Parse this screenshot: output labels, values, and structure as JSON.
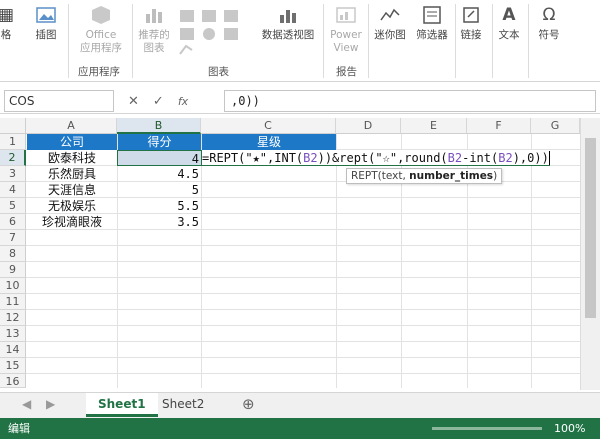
{
  "ribbon": {
    "buttons": [
      {
        "label": "格",
        "icon": "table-icon"
      },
      {
        "label": "插图",
        "icon": "picture-icon"
      },
      {
        "label": "Office\n应用程序",
        "icon": "office-apps-icon"
      },
      {
        "label": "推荐的\n图表",
        "icon": "recommended-charts-icon"
      },
      {
        "label": "数据透视图",
        "icon": "pivot-chart-icon"
      },
      {
        "label": "Power\nView",
        "icon": "power-view-icon"
      },
      {
        "label": "迷你图",
        "icon": "sparkline-icon"
      },
      {
        "label": "筛选器",
        "icon": "filter-icon"
      },
      {
        "label": "链接",
        "icon": "link-icon"
      },
      {
        "label": "文本",
        "icon": "text-icon"
      },
      {
        "label": "符号",
        "icon": "omega-icon"
      }
    ],
    "groups": {
      "apps": "应用程序",
      "charts": "图表",
      "reports": "报告"
    }
  },
  "formula_bar": {
    "name_box": "COS",
    "cancel": "✕",
    "enter": "✓",
    "fx": "fx",
    "content": ",0))"
  },
  "columns": [
    "A",
    "B",
    "C",
    "D",
    "E",
    "F",
    "G"
  ],
  "rows": [
    "1",
    "2",
    "3",
    "4",
    "5",
    "6",
    "7",
    "8",
    "9",
    "10",
    "11",
    "12",
    "13",
    "14",
    "15",
    "16"
  ],
  "table": {
    "headers": [
      "公司",
      "得分",
      "星级"
    ],
    "data": [
      {
        "company": "欧泰科技",
        "score": "4"
      },
      {
        "company": "乐然厨具",
        "score": "4.5"
      },
      {
        "company": "天涯信息",
        "score": "5"
      },
      {
        "company": "无极娱乐",
        "score": "5.5"
      },
      {
        "company": "珍视滴眼液",
        "score": "3.5"
      }
    ]
  },
  "editor": {
    "p1": "=REPT(\"★\",INT(",
    "r1": "B2",
    "p2": "))&rept(\"☆\",round(",
    "r2": "B2",
    "p3": "-int(",
    "r3": "B2",
    "p4": "),0)",
    "cursor": ")"
  },
  "tooltip": {
    "prefix": "REPT(text, ",
    "bold": "number_times",
    "suffix": ")"
  },
  "sheets": [
    "Sheet1",
    "Sheet2"
  ],
  "add_sheet": "⊕",
  "status": {
    "mode": "编辑",
    "zoom": "100%"
  },
  "colors": {
    "header_fill": "#1e78c8",
    "accent": "#217346"
  }
}
